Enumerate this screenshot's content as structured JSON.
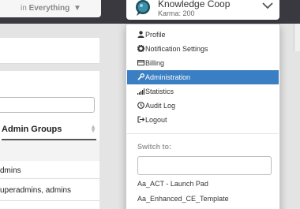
{
  "navbar": {
    "search_scope": {
      "prefix": "in",
      "value": "Everything",
      "caret": "▼"
    },
    "org": {
      "name": "Knowledge Coop",
      "karma": "Karma: 200"
    }
  },
  "background": {
    "column_header": "Admin Groups",
    "rows": [
      "dmins",
      "uperadmins, admins"
    ]
  },
  "menu": {
    "items": [
      {
        "label": "Profile",
        "icon": "user-icon"
      },
      {
        "label": "Notification Settings",
        "icon": "gear-icon"
      },
      {
        "label": "Billing",
        "icon": "credit-card-icon"
      },
      {
        "label": "Administration",
        "icon": "wrench-icon",
        "active": true
      },
      {
        "label": "Statistics",
        "icon": "signal-bars-icon"
      },
      {
        "label": "Audit Log",
        "icon": "clock-icon"
      },
      {
        "label": "Logout",
        "icon": "sign-out-icon"
      }
    ],
    "switch_label": "Switch to:",
    "switch_input_value": "",
    "orgs": [
      "Aa_ACT - Launch Pad",
      "Aa_Enhanced_CE_Template"
    ]
  },
  "colors": {
    "navbar": "#3b3940",
    "active": "#3a7fc4"
  }
}
